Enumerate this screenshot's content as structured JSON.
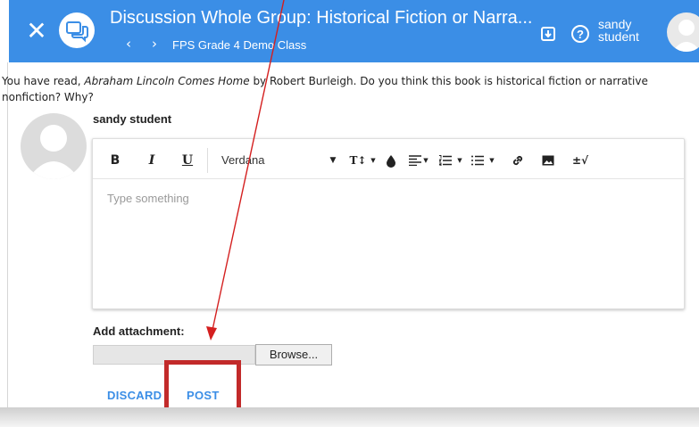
{
  "header": {
    "title": "Discussion Whole Group: Historical Fiction or Narra...",
    "class_name": "FPS Grade 4 Demo Class",
    "user_name": "sandy student",
    "color": "#3b8ee6"
  },
  "prompt": {
    "before": "You have read, ",
    "book": "Abraham Lincoln Comes Home",
    "after": " by Robert Burleigh.  Do you think this book is historical fiction or narrative nonfiction? Why?"
  },
  "post": {
    "author": "sandy student",
    "editor": {
      "font": "Verdana",
      "placeholder": "Type something",
      "toolbar": {
        "bold": "B",
        "italic": "I",
        "underline": "U",
        "text_size": "T↕",
        "math": "±√"
      }
    },
    "attachment": {
      "label": "Add attachment:",
      "browse": "Browse..."
    },
    "actions": {
      "discard": "DISCARD",
      "post": "POST"
    }
  },
  "annotation": {
    "color": "#c22a2a"
  }
}
